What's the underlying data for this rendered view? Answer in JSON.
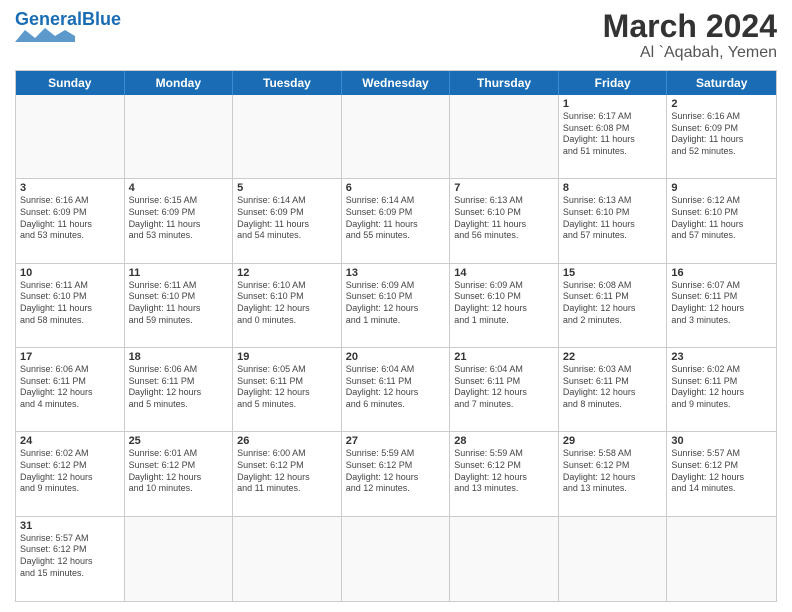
{
  "header": {
    "logo_general": "General",
    "logo_blue": "Blue",
    "month_title": "March 2024",
    "location": "Al `Aqabah, Yemen"
  },
  "day_headers": [
    "Sunday",
    "Monday",
    "Tuesday",
    "Wednesday",
    "Thursday",
    "Friday",
    "Saturday"
  ],
  "weeks": [
    [
      {
        "num": "",
        "info": ""
      },
      {
        "num": "",
        "info": ""
      },
      {
        "num": "",
        "info": ""
      },
      {
        "num": "",
        "info": ""
      },
      {
        "num": "",
        "info": ""
      },
      {
        "num": "1",
        "info": "Sunrise: 6:17 AM\nSunset: 6:08 PM\nDaylight: 11 hours\nand 51 minutes."
      },
      {
        "num": "2",
        "info": "Sunrise: 6:16 AM\nSunset: 6:09 PM\nDaylight: 11 hours\nand 52 minutes."
      }
    ],
    [
      {
        "num": "3",
        "info": "Sunrise: 6:16 AM\nSunset: 6:09 PM\nDaylight: 11 hours\nand 53 minutes."
      },
      {
        "num": "4",
        "info": "Sunrise: 6:15 AM\nSunset: 6:09 PM\nDaylight: 11 hours\nand 53 minutes."
      },
      {
        "num": "5",
        "info": "Sunrise: 6:14 AM\nSunset: 6:09 PM\nDaylight: 11 hours\nand 54 minutes."
      },
      {
        "num": "6",
        "info": "Sunrise: 6:14 AM\nSunset: 6:09 PM\nDaylight: 11 hours\nand 55 minutes."
      },
      {
        "num": "7",
        "info": "Sunrise: 6:13 AM\nSunset: 6:10 PM\nDaylight: 11 hours\nand 56 minutes."
      },
      {
        "num": "8",
        "info": "Sunrise: 6:13 AM\nSunset: 6:10 PM\nDaylight: 11 hours\nand 57 minutes."
      },
      {
        "num": "9",
        "info": "Sunrise: 6:12 AM\nSunset: 6:10 PM\nDaylight: 11 hours\nand 57 minutes."
      }
    ],
    [
      {
        "num": "10",
        "info": "Sunrise: 6:11 AM\nSunset: 6:10 PM\nDaylight: 11 hours\nand 58 minutes."
      },
      {
        "num": "11",
        "info": "Sunrise: 6:11 AM\nSunset: 6:10 PM\nDaylight: 11 hours\nand 59 minutes."
      },
      {
        "num": "12",
        "info": "Sunrise: 6:10 AM\nSunset: 6:10 PM\nDaylight: 12 hours\nand 0 minutes."
      },
      {
        "num": "13",
        "info": "Sunrise: 6:09 AM\nSunset: 6:10 PM\nDaylight: 12 hours\nand 1 minute."
      },
      {
        "num": "14",
        "info": "Sunrise: 6:09 AM\nSunset: 6:10 PM\nDaylight: 12 hours\nand 1 minute."
      },
      {
        "num": "15",
        "info": "Sunrise: 6:08 AM\nSunset: 6:11 PM\nDaylight: 12 hours\nand 2 minutes."
      },
      {
        "num": "16",
        "info": "Sunrise: 6:07 AM\nSunset: 6:11 PM\nDaylight: 12 hours\nand 3 minutes."
      }
    ],
    [
      {
        "num": "17",
        "info": "Sunrise: 6:06 AM\nSunset: 6:11 PM\nDaylight: 12 hours\nand 4 minutes."
      },
      {
        "num": "18",
        "info": "Sunrise: 6:06 AM\nSunset: 6:11 PM\nDaylight: 12 hours\nand 5 minutes."
      },
      {
        "num": "19",
        "info": "Sunrise: 6:05 AM\nSunset: 6:11 PM\nDaylight: 12 hours\nand 5 minutes."
      },
      {
        "num": "20",
        "info": "Sunrise: 6:04 AM\nSunset: 6:11 PM\nDaylight: 12 hours\nand 6 minutes."
      },
      {
        "num": "21",
        "info": "Sunrise: 6:04 AM\nSunset: 6:11 PM\nDaylight: 12 hours\nand 7 minutes."
      },
      {
        "num": "22",
        "info": "Sunrise: 6:03 AM\nSunset: 6:11 PM\nDaylight: 12 hours\nand 8 minutes."
      },
      {
        "num": "23",
        "info": "Sunrise: 6:02 AM\nSunset: 6:11 PM\nDaylight: 12 hours\nand 9 minutes."
      }
    ],
    [
      {
        "num": "24",
        "info": "Sunrise: 6:02 AM\nSunset: 6:12 PM\nDaylight: 12 hours\nand 9 minutes."
      },
      {
        "num": "25",
        "info": "Sunrise: 6:01 AM\nSunset: 6:12 PM\nDaylight: 12 hours\nand 10 minutes."
      },
      {
        "num": "26",
        "info": "Sunrise: 6:00 AM\nSunset: 6:12 PM\nDaylight: 12 hours\nand 11 minutes."
      },
      {
        "num": "27",
        "info": "Sunrise: 5:59 AM\nSunset: 6:12 PM\nDaylight: 12 hours\nand 12 minutes."
      },
      {
        "num": "28",
        "info": "Sunrise: 5:59 AM\nSunset: 6:12 PM\nDaylight: 12 hours\nand 13 minutes."
      },
      {
        "num": "29",
        "info": "Sunrise: 5:58 AM\nSunset: 6:12 PM\nDaylight: 12 hours\nand 13 minutes."
      },
      {
        "num": "30",
        "info": "Sunrise: 5:57 AM\nSunset: 6:12 PM\nDaylight: 12 hours\nand 14 minutes."
      }
    ],
    [
      {
        "num": "31",
        "info": "Sunrise: 5:57 AM\nSunset: 6:12 PM\nDaylight: 12 hours\nand 15 minutes."
      },
      {
        "num": "",
        "info": ""
      },
      {
        "num": "",
        "info": ""
      },
      {
        "num": "",
        "info": ""
      },
      {
        "num": "",
        "info": ""
      },
      {
        "num": "",
        "info": ""
      },
      {
        "num": "",
        "info": ""
      }
    ]
  ]
}
